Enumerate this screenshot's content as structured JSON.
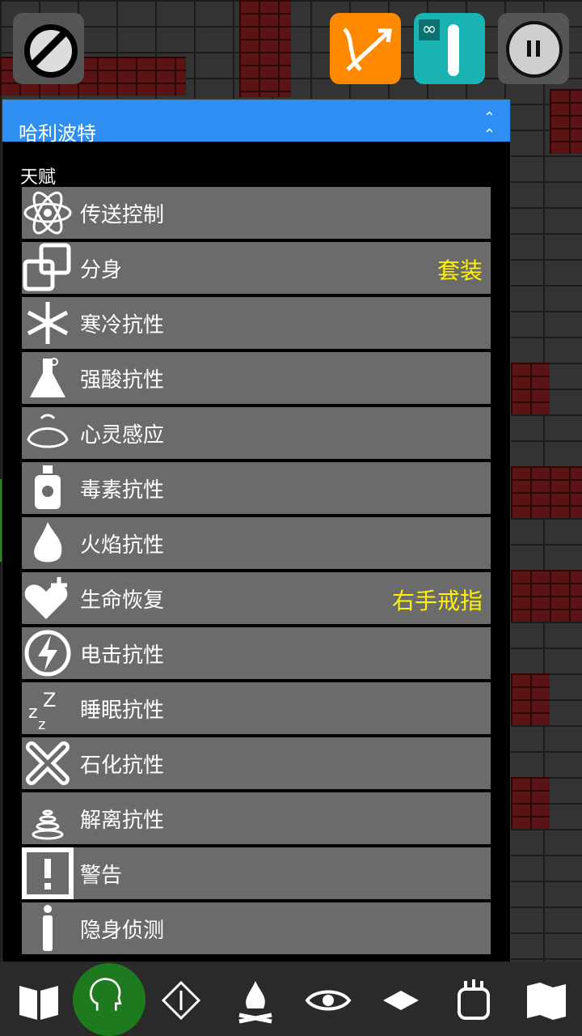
{
  "panel": {
    "title": "哈利波特",
    "collapse_icon": "double-chevron-up",
    "section": "天赋"
  },
  "talents": [
    {
      "label": "传送控制",
      "icon": "atom-icon",
      "tag": ""
    },
    {
      "label": "分身",
      "icon": "clone-icon",
      "tag": "套装"
    },
    {
      "label": "寒冷抗性",
      "icon": "snowflake-icon",
      "tag": ""
    },
    {
      "label": "强酸抗性",
      "icon": "flask-icon",
      "tag": ""
    },
    {
      "label": "心灵感应",
      "icon": "telepathy-head-icon",
      "tag": ""
    },
    {
      "label": "毒素抗性",
      "icon": "poison-bottle-icon",
      "tag": ""
    },
    {
      "label": "火焰抗性",
      "icon": "fire-icon",
      "tag": ""
    },
    {
      "label": "生命恢复",
      "icon": "heart-plus-icon",
      "tag": "右手戒指"
    },
    {
      "label": "电击抗性",
      "icon": "lightning-icon",
      "tag": ""
    },
    {
      "label": "睡眠抗性",
      "icon": "zzz-icon",
      "tag": ""
    },
    {
      "label": "石化抗性",
      "icon": "cross-icon",
      "tag": ""
    },
    {
      "label": "解离抗性",
      "icon": "spiral-icon",
      "tag": ""
    },
    {
      "label": "警告",
      "icon": "exclamation-icon",
      "tag": ""
    },
    {
      "label": "隐身侦测",
      "icon": "figure-icon",
      "tag": ""
    }
  ],
  "colors": {
    "header": "#2f8ef2",
    "row": "#6b6b6b",
    "tag": "#fff200",
    "bow_button": "#ff8a00",
    "wand_button": "#1ab3b3"
  },
  "top_buttons": [
    "cancel-icon",
    "bow-arrow-icon",
    "wand-icon",
    "pause-icon"
  ],
  "wand": {
    "symbol": "∞"
  },
  "bottom_bar": [
    "book-icon",
    "head-icon",
    "compass-icon",
    "campfire-icon",
    "eye-icon",
    "grid-icon",
    "hand-icon",
    "map-icon"
  ]
}
